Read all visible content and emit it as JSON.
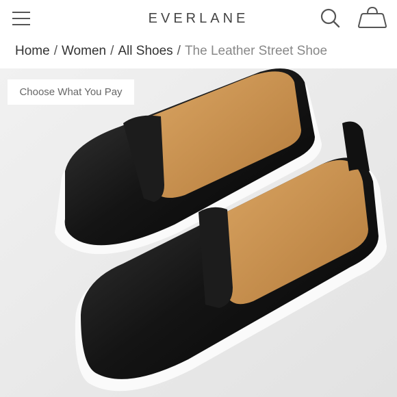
{
  "header": {
    "brand": "EVERLANE",
    "menu_icon": "hamburger-menu-icon",
    "search_icon": "search-icon",
    "cart_icon": "shopping-bag-icon"
  },
  "breadcrumb": {
    "items": [
      "Home",
      "Women",
      "All Shoes"
    ],
    "separator": "/",
    "current": "The Leather Street Shoe"
  },
  "product": {
    "badge_label": "Choose What You Pay",
    "image_alt": "Black leather slip-on shoes with white soles"
  },
  "colors": {
    "background": "#ffffff",
    "text": "#333333",
    "muted_text": "#888888",
    "image_background": "#ececec"
  }
}
